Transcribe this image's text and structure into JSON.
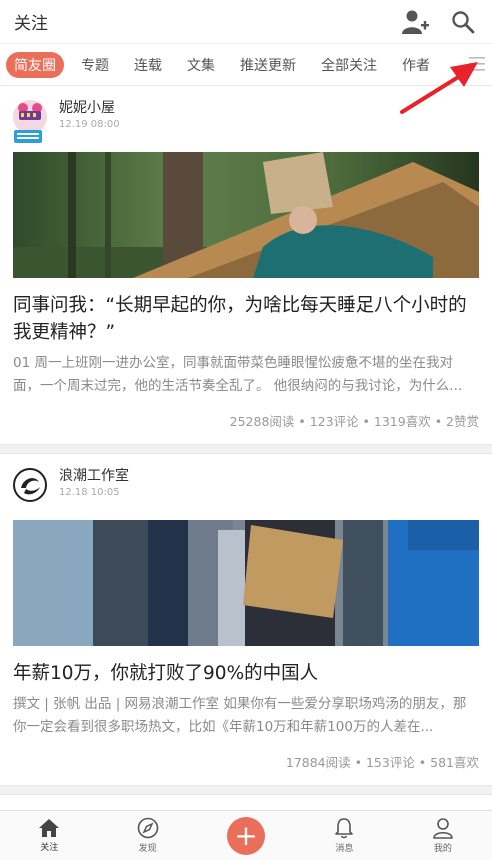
{
  "header": {
    "title": "关注",
    "add_user_icon": "add-user-icon",
    "search_icon": "search-icon"
  },
  "tabs": [
    {
      "label": "简友圈",
      "active": true
    },
    {
      "label": "专题",
      "active": false
    },
    {
      "label": "连载",
      "active": false
    },
    {
      "label": "文集",
      "active": false
    },
    {
      "label": "推送更新",
      "active": false
    },
    {
      "label": "全部关注",
      "active": false
    },
    {
      "label": "作者",
      "active": false
    }
  ],
  "colors": {
    "accent": "#ea6f5a",
    "annotation_arrow": "#e8232a"
  },
  "feed": [
    {
      "author": "妮妮小屋",
      "time": "12.19 08:00",
      "title": "同事问我：“长期早起的你，为啥比每天睡足八个小时的我更精神？”",
      "excerpt": "01 周一上班刚一进办公室，同事就面带菜色睡眼惺忪疲惫不堪的坐在我对面，一个周末过完，他的生活节奏全乱了。 他很纳闷的与我讨论，为什么...",
      "stats": "25288阅读 • 123评论 • 1319喜欢 • 2赞赏"
    },
    {
      "author": "浪潮工作室",
      "time": "12.18 10:05",
      "title": "年薪10万，你就打败了90%的中国人",
      "excerpt": "撰文 | 张帆 出品 | 网易浪潮工作室 如果你有一些爱分享职场鸡汤的朋友，那你一定会看到很多职场热文，比如《年薪10万和年薪100万的人差在...",
      "stats": "17884阅读 • 153评论 • 581喜欢"
    }
  ],
  "bottom_nav": [
    {
      "label": "关注",
      "icon": "home-icon",
      "active": true
    },
    {
      "label": "发现",
      "icon": "compass-icon",
      "active": false
    },
    {
      "label": "",
      "icon": "plus-icon",
      "active": false
    },
    {
      "label": "消息",
      "icon": "bell-icon",
      "active": false
    },
    {
      "label": "我的",
      "icon": "user-icon",
      "active": false
    }
  ]
}
